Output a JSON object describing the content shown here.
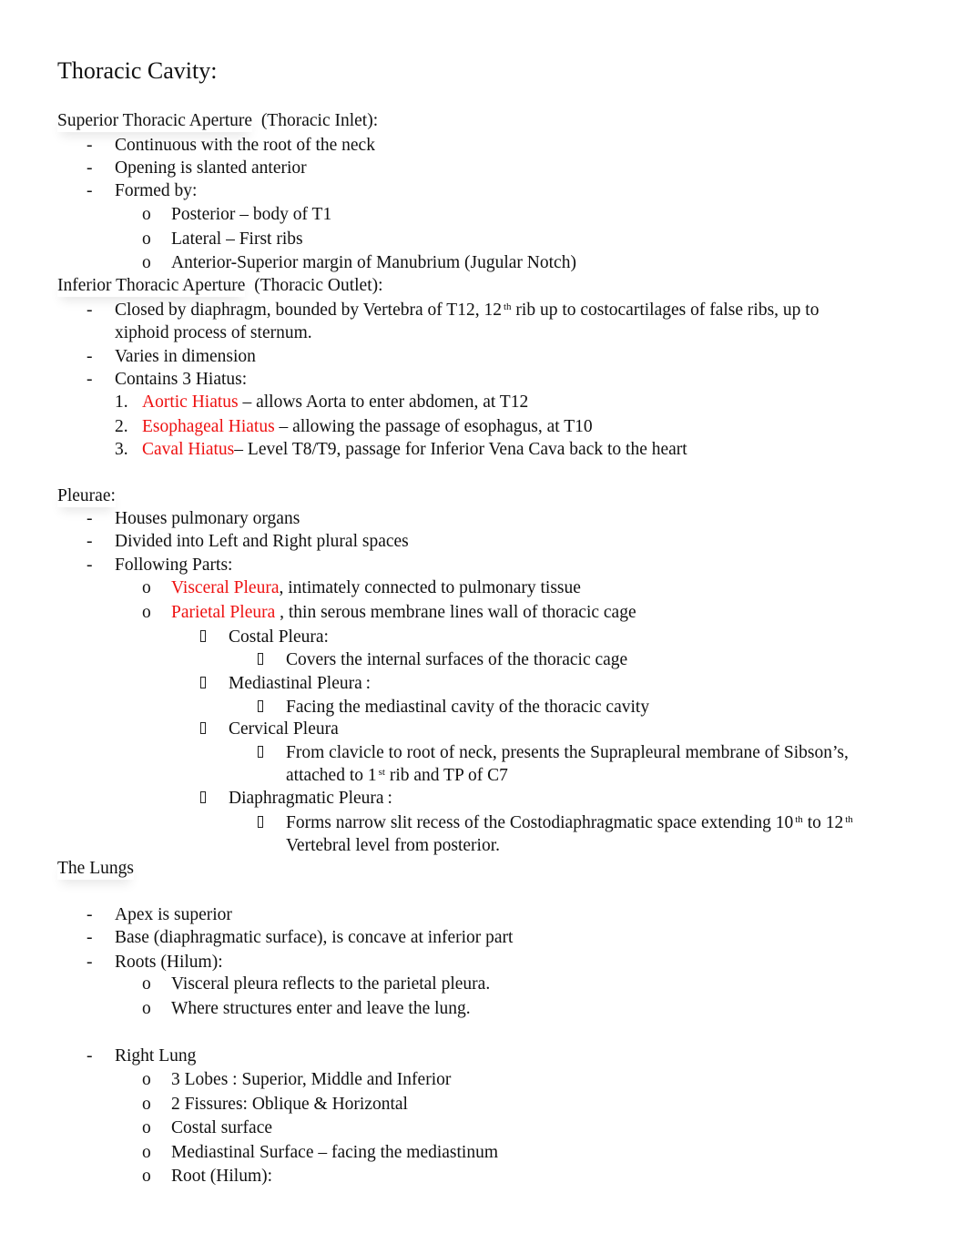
{
  "document": {
    "title": "Thoracic Cavity:",
    "sections": {
      "superior": {
        "heading": "Superior Thoracic Aperture",
        "heading_suffix": "(Thoracic Inlet):",
        "bullets": [
          "Continuous with the root of the neck",
          "Opening is slanted anterior",
          "Formed by:"
        ],
        "formed_by": [
          "Posterior – body of T1",
          "Lateral – First ribs",
          "Anterior-Superior margin of Manubrium (Jugular Notch)"
        ]
      },
      "inferior": {
        "heading": "Inferior Thoracic Aperture",
        "heading_suffix": "(Thoracic Outlet):",
        "bullet1_a": "Closed by diaphragm, bounded by Vertebra of T12, 12",
        "bullet1_sup": "th",
        "bullet1_b": "rib up to costocartilages of false ribs, up to",
        "bullet1_cont": "xiphoid process of sternum.",
        "bullet2": "Varies in dimension",
        "bullet3": "Contains 3 Hiatus:",
        "hiatus": [
          {
            "num": "1.",
            "name": "Aortic Hiatus",
            "desc": " – allows Aorta to enter abdomen, at T12"
          },
          {
            "num": "2.",
            "name": "Esophageal Hiatus",
            "desc": " – allowing the passage of esophagus, at T10"
          },
          {
            "num": "3.",
            "name": "Caval Hiatus",
            "desc": "– Level T8/T9, passage for Inferior Vena Cava back to the heart"
          }
        ]
      },
      "pleurae": {
        "heading": "Pleurae:",
        "bullets": [
          "Houses pulmonary organs",
          "Divided into Left and Right plural spaces",
          "Following Parts:"
        ],
        "visceral_name": "Visceral Pleura",
        "visceral_desc": ", intimately connected to pulmonary tissue",
        "parietal_name": "Parietal Pleura",
        "parietal_desc": " , thin serous membrane lines wall of thoracic cage",
        "costal": "Costal Pleura:",
        "costal_desc": "Covers the internal surfaces of the thoracic cage",
        "mediastinal": "Mediastinal Pleura :",
        "mediastinal_desc": "Facing the mediastinal cavity of the thoracic cavity",
        "cervical": "Cervical Pleura",
        "cervical_desc": "From clavicle to root of neck, presents the Suprapleural membrane of Sibson’s,",
        "cervical_cont_a": "attached to 1",
        "cervical_cont_sup": "st",
        "cervical_cont_b": "rib and TP of C7",
        "diaphragmatic": "Diaphragmatic Pleura :",
        "diaphragmatic_desc_a": "Forms narrow slit recess of the Costodiaphragmatic space extending 10",
        "diaphragmatic_sup1": "th",
        "diaphragmatic_desc_b": "to 12",
        "diaphragmatic_sup2": "th",
        "diaphragmatic_cont": "Vertebral level from posterior."
      },
      "lungs": {
        "heading": "The Lungs",
        "bullets": [
          "Apex is superior",
          "Base (diaphragmatic surface), is concave at inferior part",
          "Roots (Hilum):"
        ],
        "roots": [
          "Visceral pleura reflects to the parietal pleura.",
          "Where structures enter and leave the lung."
        ],
        "right_lung": "Right Lung",
        "right_lung_items": [
          "3 Lobes : Superior, Middle and Inferior",
          "2 Fissures: Oblique & Horizontal",
          "Costal surface",
          "Mediastinal Surface – facing the mediastinum",
          "Root (Hilum):"
        ]
      }
    },
    "markers": {
      "dash": "-",
      "circle": "o"
    }
  }
}
